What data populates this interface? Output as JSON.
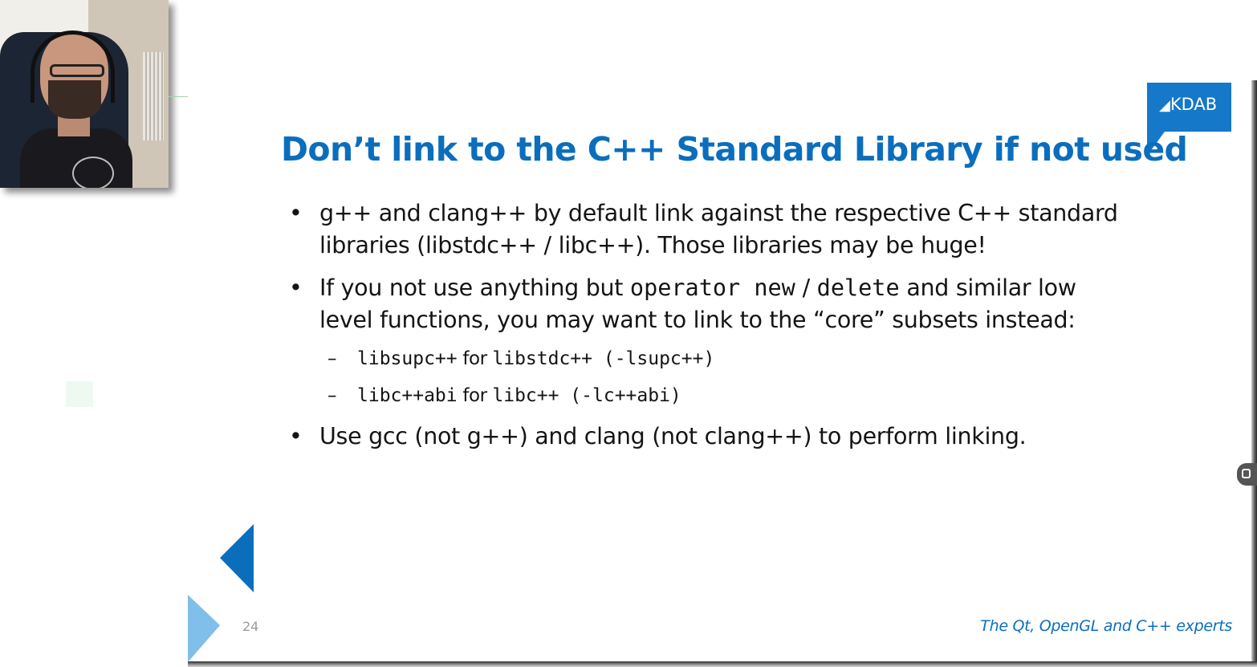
{
  "slide": {
    "title": "Don’t link to the C++ Standard Library if not used",
    "logo": "KDAB",
    "bullets": [
      {
        "line1": "g++ and clang++ by default link against the respective C++ standard",
        "line2": "libraries (libstdc++ / libc++). Those libraries may be huge!"
      },
      {
        "pre": "If you not use anything but ",
        "code1": "operator new",
        "sep": " / ",
        "code2": "delete",
        "post": " and similar low",
        "line2": "level functions, you may want to link to the “core” subsets instead:",
        "subitems": [
          {
            "lib": "libsupc++",
            "for": " for ",
            "target": "libstdc++ (-lsupc++)"
          },
          {
            "lib": "libc++abi",
            "for": " for ",
            "target": "libc++ (-lc++abi)"
          }
        ]
      },
      {
        "line1": "Use gcc (not g++) and clang (not clang++) to perform linking."
      }
    ],
    "page_number": "24",
    "footer": "The Qt, OpenGL and C++ experts",
    "bullet_glyph": "•",
    "dash_glyph": "–"
  },
  "colors": {
    "accent": "#0b6ebd",
    "logo_bg": "#1578c8",
    "arrow_light": "#7fbfe9",
    "text": "#141414"
  },
  "icons": [
    "kdab-logo-icon",
    "previous-slide-arrow-icon",
    "side-panel-toggle-icon"
  ]
}
